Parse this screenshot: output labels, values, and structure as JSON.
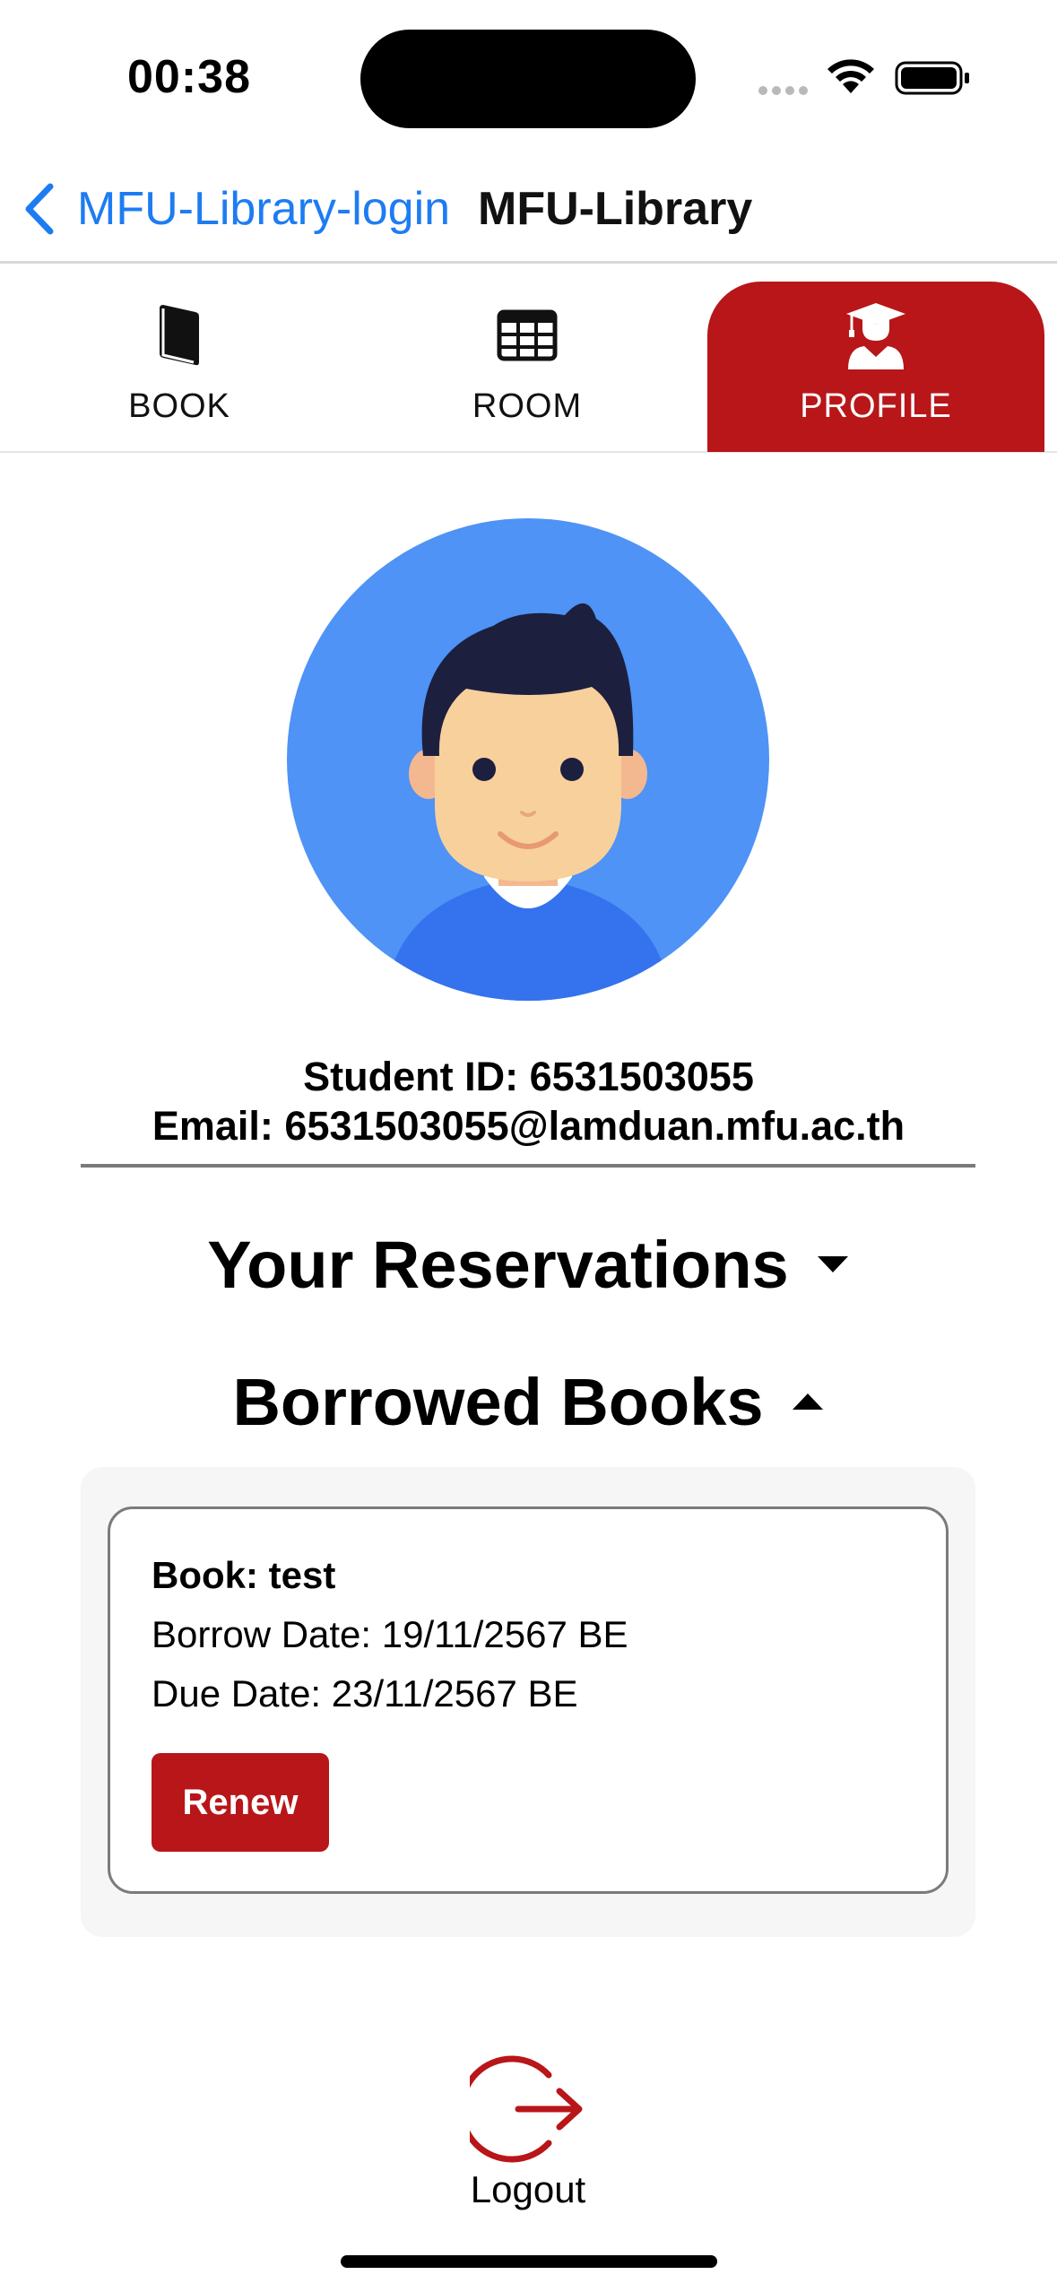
{
  "status_bar": {
    "time": "00:38"
  },
  "nav": {
    "back_label": "MFU-Library-login",
    "title": "MFU-Library"
  },
  "tabs": [
    {
      "label": "BOOK",
      "icon": "book-icon",
      "active": false
    },
    {
      "label": "ROOM",
      "icon": "grid-table-icon",
      "active": false
    },
    {
      "label": "PROFILE",
      "icon": "graduate-user-icon",
      "active": true
    }
  ],
  "profile": {
    "student_id": "Student ID: 6531503055",
    "email": "Email: 6531503055@lamduan.mfu.ac.th"
  },
  "sections": {
    "reservations": {
      "title": "Your Reservations",
      "expanded": false
    },
    "borrowed": {
      "title": "Borrowed Books",
      "expanded": true
    }
  },
  "borrowed_books": [
    {
      "title": "Book: test",
      "borrow_date": "Borrow Date: 19/11/2567 BE",
      "due_date": "Due Date: 23/11/2567 BE",
      "renew_label": "Renew"
    }
  ],
  "logout": {
    "label": "Logout"
  },
  "colors": {
    "accent_red": "#b81619",
    "link_blue": "#1e7cf2",
    "avatar_bg": "#4e93f5"
  }
}
